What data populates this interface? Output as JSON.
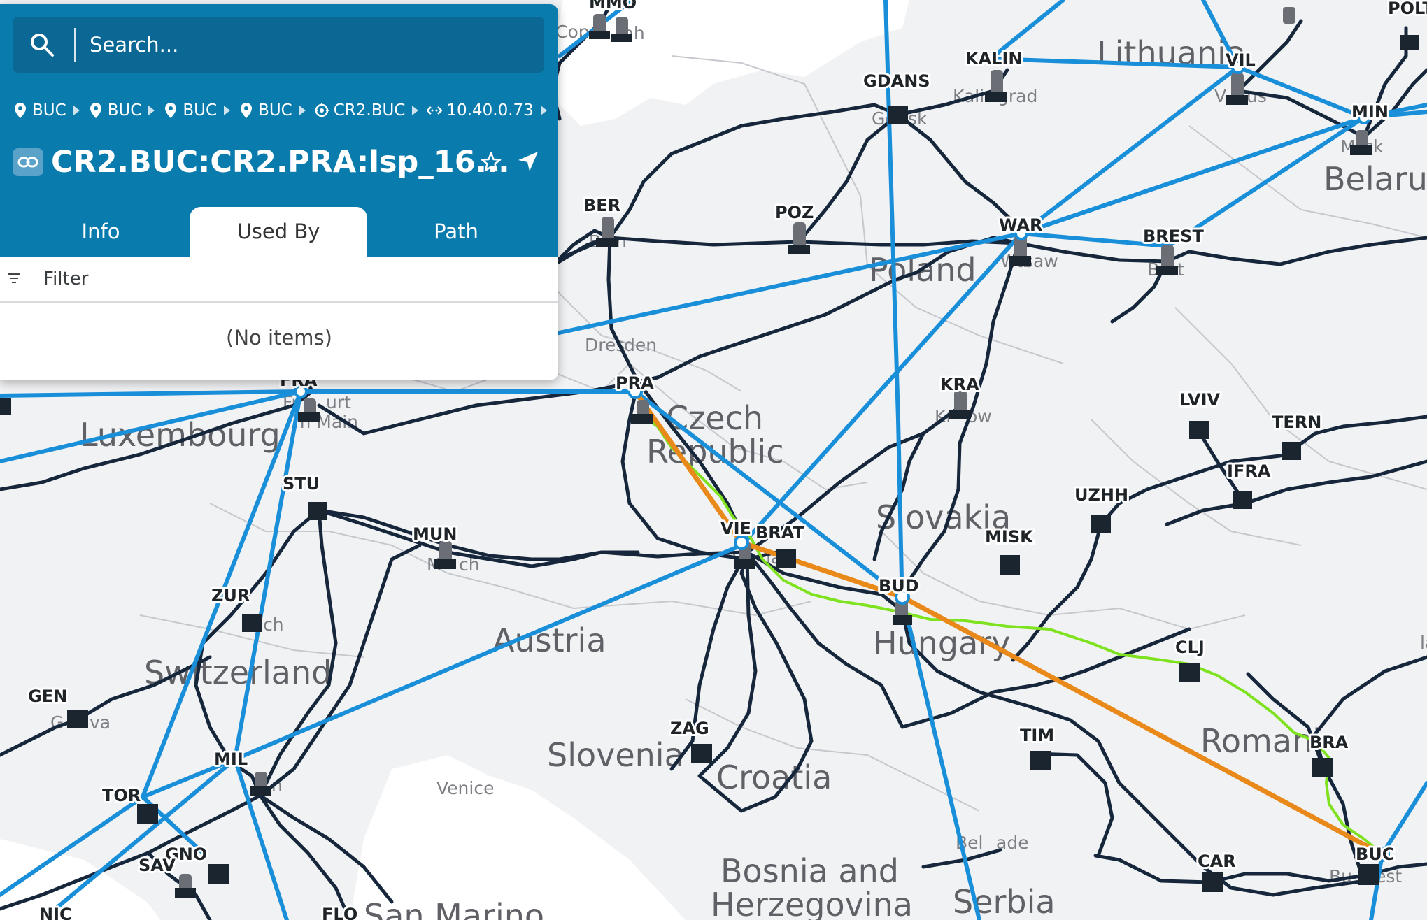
{
  "search": {
    "placeholder": "Search..."
  },
  "breadcrumb": [
    {
      "icon": "location-pin-icon",
      "label": "BUC"
    },
    {
      "icon": "location-pin-icon",
      "label": "BUC"
    },
    {
      "icon": "location-pin-icon",
      "label": "BUC"
    },
    {
      "icon": "location-pin-icon",
      "label": "BUC"
    },
    {
      "icon": "router-icon",
      "label": "CR2.BUC"
    },
    {
      "icon": "interface-icon",
      "label": "10.40.0.73"
    }
  ],
  "header": {
    "title": "CR2.BUC:CR2.PRA:lsp_16...",
    "title_icon": "link-icon"
  },
  "tabs": [
    {
      "label": "Info",
      "active": false
    },
    {
      "label": "Used By",
      "active": true
    },
    {
      "label": "Path",
      "active": false
    }
  ],
  "filter": {
    "label": "Filter"
  },
  "list": {
    "empty_text": "(No items)"
  },
  "colors": {
    "panel": "#0a7bad",
    "search": "#0b6894",
    "link": "#1a8fd9",
    "road": "#16263b",
    "lsp_path": "#e8891a",
    "alt_path": "#7ee21e"
  },
  "map": {
    "countries": [
      "Lithuania",
      "Belarus",
      "Poland",
      "Czech",
      "Republic",
      "Slovakia",
      "Luxembourg",
      "Austria",
      "Hungary",
      "Switzerland",
      "Slovenia",
      "Croatia",
      "Romani",
      "Bosnia and",
      "Herzegovina",
      "Serbia",
      "San Marino"
    ],
    "cities": [
      "Cope",
      "nh",
      "Kalin",
      "grad",
      "Gd",
      "sk",
      "V",
      "us",
      "M",
      "sk",
      "B",
      "n",
      "Wa",
      "saw",
      "B",
      "st",
      "Dres",
      "den",
      "Fr",
      "urt",
      "m Main",
      "Kr",
      "ow",
      "M",
      "ch",
      "Vi",
      "na",
      "Z",
      "ch",
      "G",
      "va",
      "Venice",
      "Bel",
      "ade",
      "Bu",
      "est",
      "n",
      "la"
    ],
    "nodes": [
      "MMO",
      "KALIN",
      "VIL",
      "POLT",
      "GDANS",
      "MIN",
      "BER",
      "POZ",
      "WAR",
      "BREST",
      "PRA",
      "KRA",
      "LVIV",
      "TERN",
      "IFRA",
      "UZHH",
      "STU",
      "MUN",
      "VIE",
      "BRAT",
      "MISK",
      "BUD",
      "ZUR",
      "CLJ",
      "GEN",
      "ZAG",
      "TIM",
      "BRA",
      "MIL",
      "TOR",
      "GNO",
      "SAV",
      "BUC",
      "CAR",
      "NIC",
      "FLO",
      "FRA"
    ]
  }
}
